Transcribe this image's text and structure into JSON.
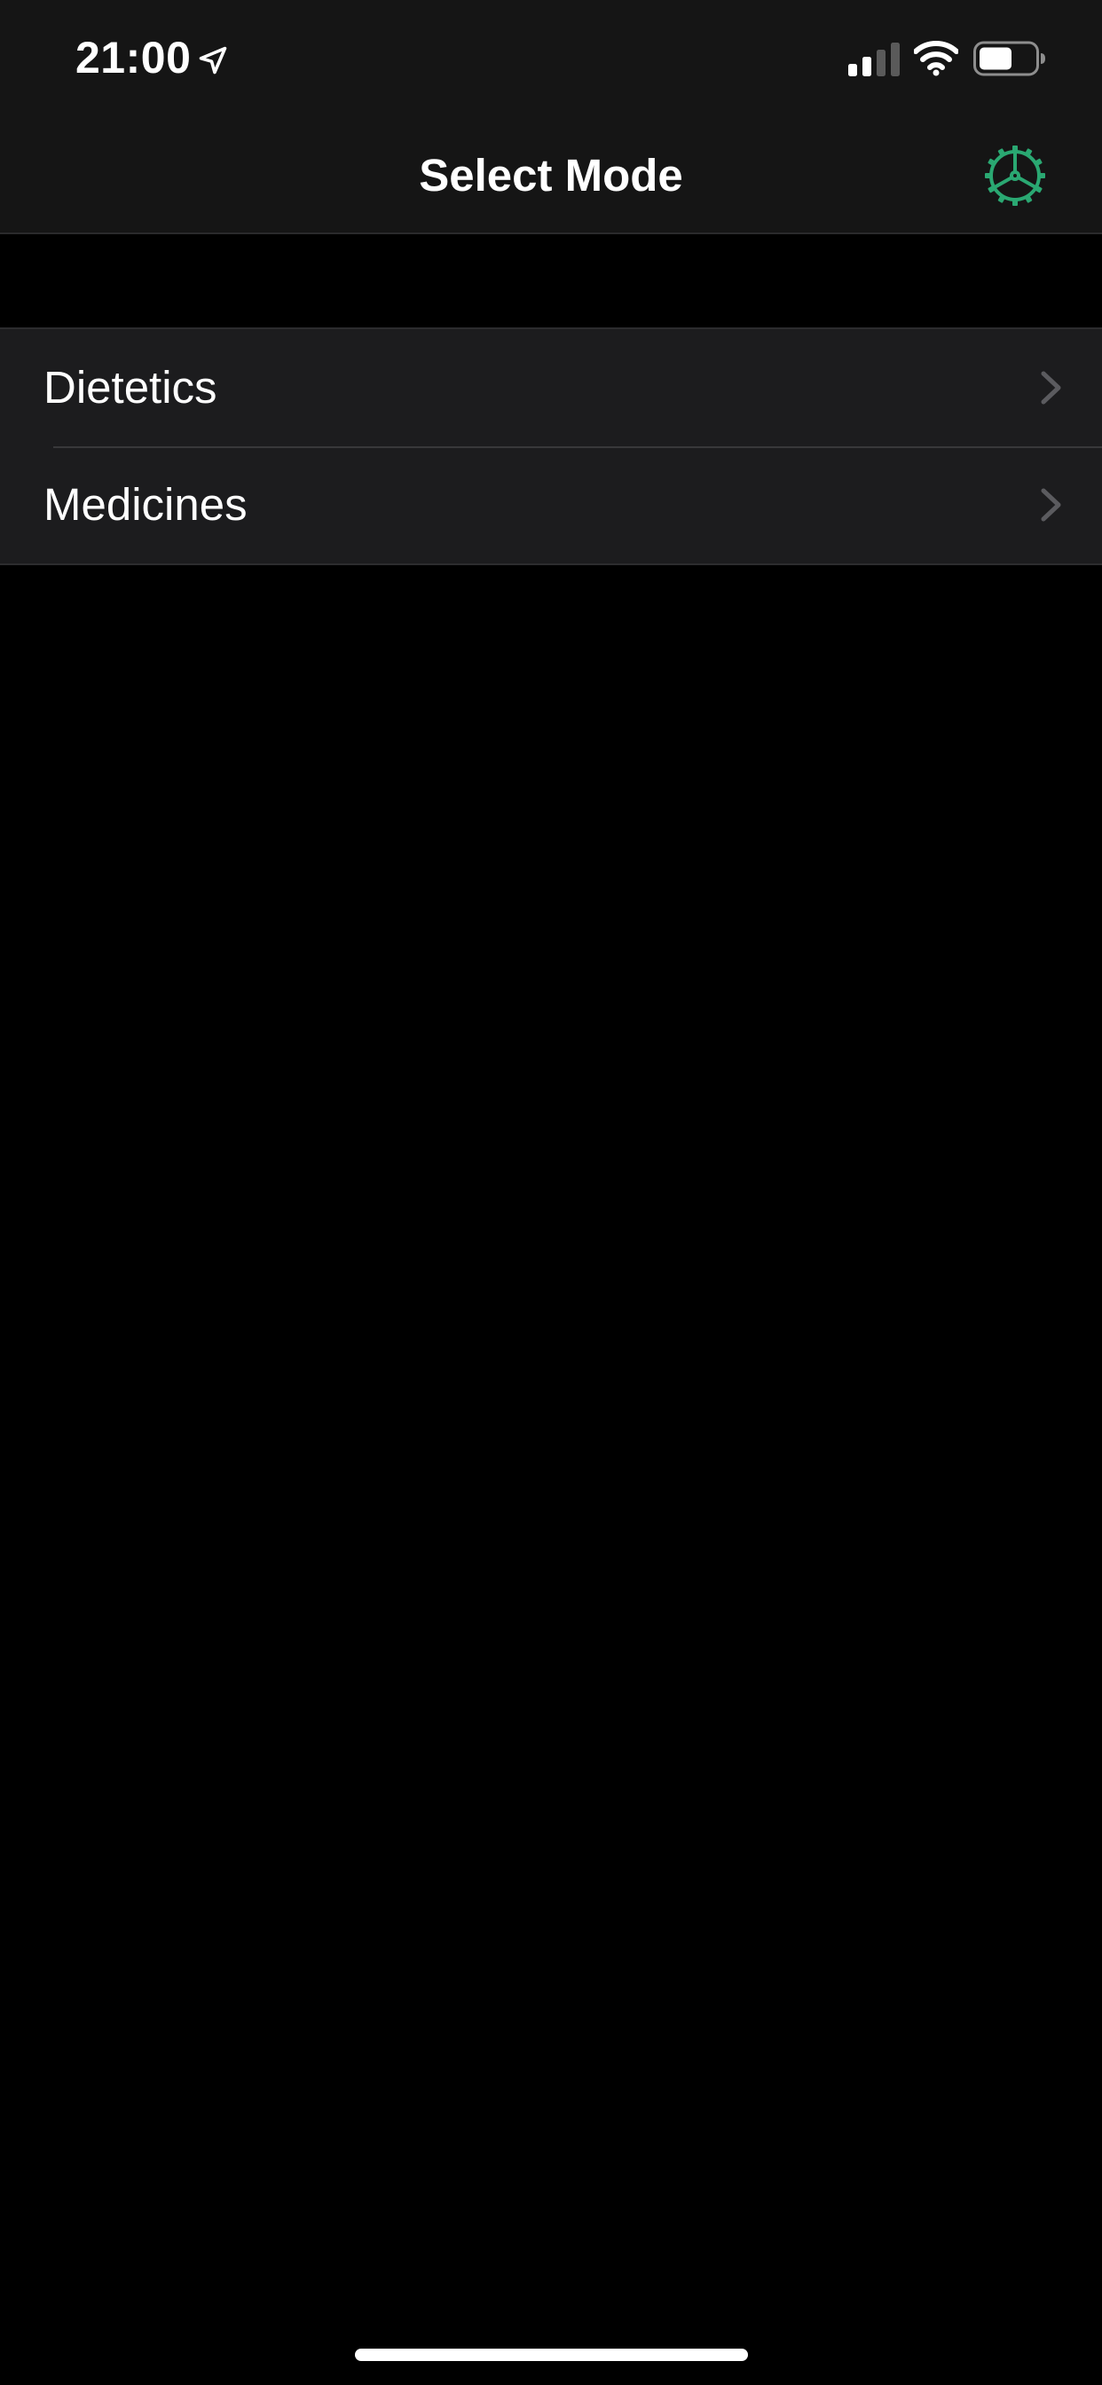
{
  "status_bar": {
    "time": "21:00",
    "icons": [
      "location-arrow-icon",
      "cellular-signal-icon",
      "wifi-icon",
      "battery-icon"
    ]
  },
  "nav": {
    "title": "Select Mode",
    "settings_icon": "gear-icon"
  },
  "colors": {
    "accent": "#2aa872",
    "background": "#000000",
    "bar_background": "#151515",
    "cell_background": "#1c1c1e",
    "chevron": "#5b5b5f"
  },
  "modes": [
    {
      "label": "Dietetics",
      "icon": "chevron-right-icon"
    },
    {
      "label": "Medicines",
      "icon": "chevron-right-icon"
    }
  ]
}
